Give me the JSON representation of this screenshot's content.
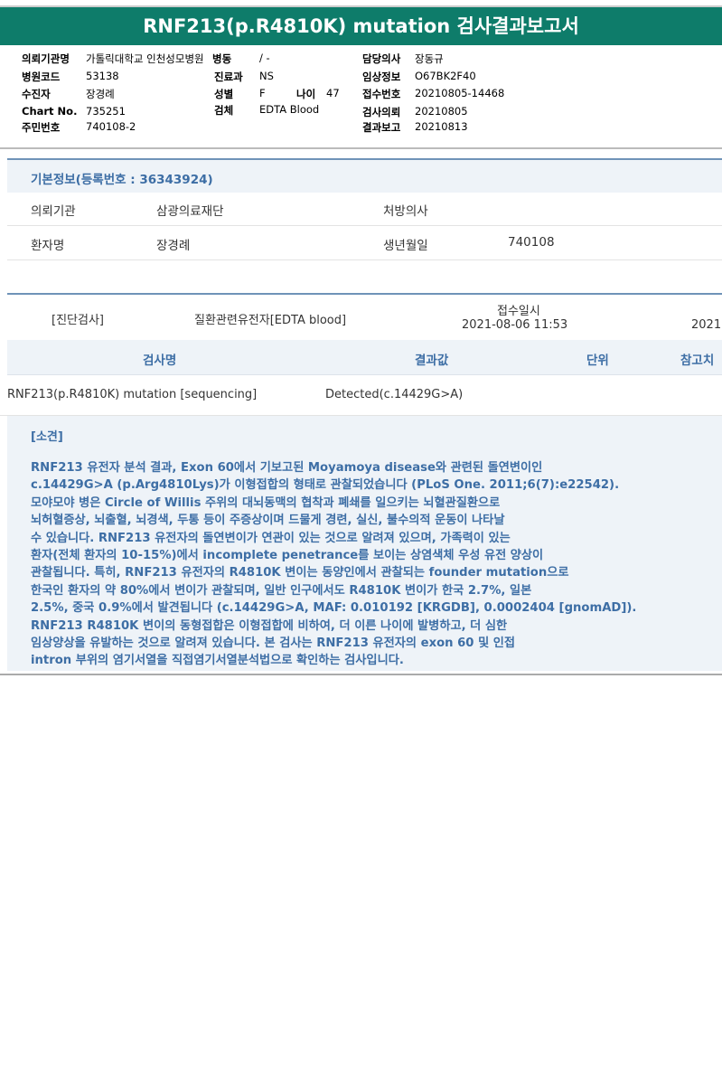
{
  "title": "RNF213(p.R4810K) mutation 검사결과보고서",
  "header": {
    "hospital_label": "의뢰기관명",
    "hospital_value": "가톨릭대학교 인천성모병원",
    "ward_label": "병동",
    "ward_value": "/ -",
    "doctor_label": "담당의사",
    "doctor_value": "장동규",
    "code_label": "병원코드",
    "code_value": "53138",
    "dept_label": "진료과",
    "dept_value": "NS",
    "clinical_label": "임상정보",
    "clinical_value": "O67BK2F40",
    "patient_label": "수진자",
    "patient_value": "장경례",
    "sex_label": "성별",
    "sex_value": "F",
    "age_label": "나이",
    "age_value": "47",
    "receipt_label": "접수번호",
    "receipt_value": "20210805-14468",
    "chart_label": "Chart No.",
    "chart_value": "735251",
    "specimen_label": "검체",
    "specimen_value": "EDTA Blood",
    "request_label": "검사의뢰",
    "request_value": "20210805",
    "rrn_label": "주민번호",
    "rrn_value": "740108-2",
    "report_label": "결과보고",
    "report_value": "20210813"
  },
  "basic": {
    "heading": "기본정보(등록번호 : 36343924)",
    "org_label": "의뢰기관",
    "org_value": "삼광의료재단",
    "doctor_label": "처방의사",
    "doctor_value": "",
    "name_label": "환자명",
    "name_value": "장경례",
    "birth_label": "생년월일",
    "birth_value": "740108"
  },
  "exam": {
    "category": "[진단검사]",
    "test": "질환관련유전자[EDTA blood]",
    "received_label": "접수일시",
    "received_value": "2021-08-06  11:53",
    "extra": "2021"
  },
  "table": {
    "headers": [
      "검사명",
      "결과값",
      "단위",
      "참고치"
    ],
    "row": {
      "name": "RNF213(p.R4810K) mutation [sequencing]",
      "result": "Detected(c.14429G>A)",
      "unit": "",
      "ref": ""
    }
  },
  "findings": {
    "title": "[소견]",
    "text": "RNF213 유전자 분석 결과, Exon 60에서 기보고된 Moyamoya disease와 관련된 돌연변이인\nc.14429G>A (p.Arg4810Lys)가 이형접합의 형태로 관찰되었습니다 (PLoS One. 2011;6(7):e22542).\n모야모야 병은 Circle of Willis 주위의 대뇌동맥의 협착과 폐쇄를 일으키는 뇌혈관질환으로\n뇌허혈증상, 뇌출혈, 뇌경색, 두통 등이 주증상이며 드물게 경련, 실신, 불수의적 운동이 나타날\n수 있습니다. RNF213 유전자의 돌연변이가 연관이 있는 것으로 알려져 있으며, 가족력이 있는\n환자(전체 환자의 10-15%)에서 incomplete penetrance를 보이는 상염색체 우성 유전 양상이\n관찰됩니다. 특히, RNF213 유전자의 R4810K 변이는 동양인에서 관찰되는 founder mutation으로\n한국인 환자의 약 80%에서 변이가 관찰되며, 일반 인구에서도 R4810K 변이가 한국 2.7%, 일본\n2.5%, 중국 0.9%에서 발견됩니다 (c.14429G>A, MAF: 0.010192 [KRGDB], 0.0002404 [gnomAD]).\nRNF213 R4810K 변이의 동형접합은 이형접합에 비하여, 더 이른 나이에 발병하고, 더 심한\n임상양상을 유발하는 것으로 알려져 있습니다. 본 검사는 RNF213 유전자의 exon 60 및 인접\nintron 부위의 염기서열을 직접염기서열분석법으로 확인하는 검사입니다."
  }
}
